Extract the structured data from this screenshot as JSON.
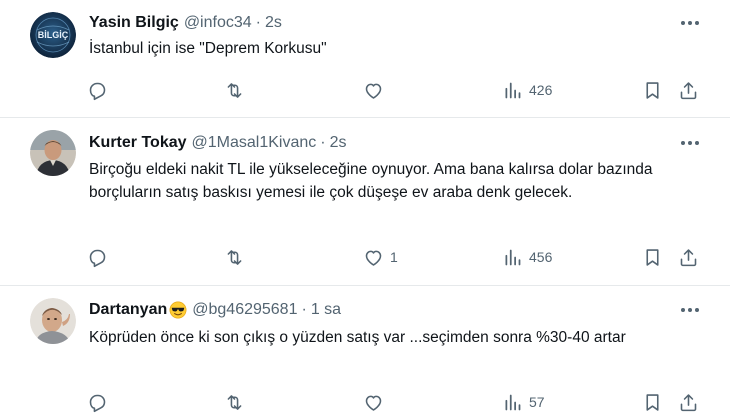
{
  "tweets": [
    {
      "name": "Yasin Bilgiç",
      "handle": "@infoc34",
      "separator": "·",
      "time": "2s",
      "text": "İstanbul için ise \"Deprem Korkusu\"",
      "avatar_text": "BİLGİÇ",
      "replies": "",
      "retweets": "",
      "likes": "",
      "views": "426"
    },
    {
      "name": "Kurter Tokay",
      "handle": "@1Masal1Kivanc",
      "separator": "·",
      "time": "2s",
      "text": "Birçoğu eldeki nakit TL ile yükseleceğine oynuyor. Ama bana kalırsa dolar bazında borçluların satış baskısı yemesi ile çok düşeşe ev araba denk gelecek.",
      "replies": "",
      "retweets": "",
      "likes": "1",
      "views": "456"
    },
    {
      "name": "Dartanyan",
      "name_emoji": "smiling-face-with-sunglasses",
      "handle": "@bg46295681",
      "separator": "·",
      "time": "1 sa",
      "text": "Köprüden önce ki son çıkış o yüzden  satış var ...seçimden sonra %30-40 artar",
      "replies": "",
      "retweets": "",
      "likes": "",
      "views": "57"
    }
  ],
  "icons": {
    "reply": "reply-icon",
    "retweet": "retweet-icon",
    "like": "like-icon",
    "views": "views-icon",
    "bookmark": "bookmark-icon",
    "share": "share-icon",
    "more": "more-options-icon"
  },
  "colors": {
    "text": "#0f1419",
    "secondary": "#536471",
    "divider": "#e6e9eb",
    "background": "#ffffff"
  }
}
